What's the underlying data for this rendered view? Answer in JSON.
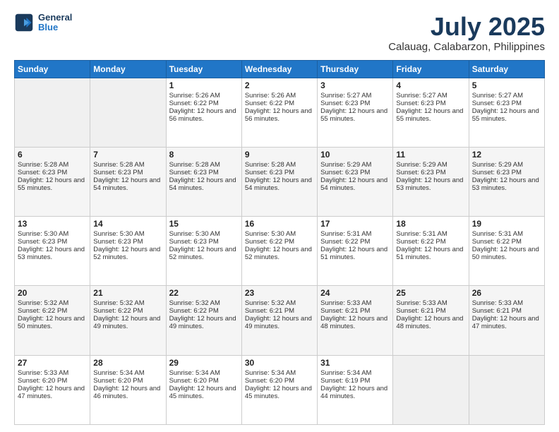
{
  "header": {
    "logo_line1": "General",
    "logo_line2": "Blue",
    "title": "July 2025",
    "subtitle": "Calauag, Calabarzon, Philippines"
  },
  "weekdays": [
    "Sunday",
    "Monday",
    "Tuesday",
    "Wednesday",
    "Thursday",
    "Friday",
    "Saturday"
  ],
  "weeks": [
    [
      {
        "day": "",
        "content": ""
      },
      {
        "day": "",
        "content": ""
      },
      {
        "day": "1",
        "content": "Sunrise: 5:26 AM\nSunset: 6:22 PM\nDaylight: 12 hours and 56 minutes."
      },
      {
        "day": "2",
        "content": "Sunrise: 5:26 AM\nSunset: 6:22 PM\nDaylight: 12 hours and 56 minutes."
      },
      {
        "day": "3",
        "content": "Sunrise: 5:27 AM\nSunset: 6:23 PM\nDaylight: 12 hours and 55 minutes."
      },
      {
        "day": "4",
        "content": "Sunrise: 5:27 AM\nSunset: 6:23 PM\nDaylight: 12 hours and 55 minutes."
      },
      {
        "day": "5",
        "content": "Sunrise: 5:27 AM\nSunset: 6:23 PM\nDaylight: 12 hours and 55 minutes."
      }
    ],
    [
      {
        "day": "6",
        "content": "Sunrise: 5:28 AM\nSunset: 6:23 PM\nDaylight: 12 hours and 55 minutes."
      },
      {
        "day": "7",
        "content": "Sunrise: 5:28 AM\nSunset: 6:23 PM\nDaylight: 12 hours and 54 minutes."
      },
      {
        "day": "8",
        "content": "Sunrise: 5:28 AM\nSunset: 6:23 PM\nDaylight: 12 hours and 54 minutes."
      },
      {
        "day": "9",
        "content": "Sunrise: 5:28 AM\nSunset: 6:23 PM\nDaylight: 12 hours and 54 minutes."
      },
      {
        "day": "10",
        "content": "Sunrise: 5:29 AM\nSunset: 6:23 PM\nDaylight: 12 hours and 54 minutes."
      },
      {
        "day": "11",
        "content": "Sunrise: 5:29 AM\nSunset: 6:23 PM\nDaylight: 12 hours and 53 minutes."
      },
      {
        "day": "12",
        "content": "Sunrise: 5:29 AM\nSunset: 6:23 PM\nDaylight: 12 hours and 53 minutes."
      }
    ],
    [
      {
        "day": "13",
        "content": "Sunrise: 5:30 AM\nSunset: 6:23 PM\nDaylight: 12 hours and 53 minutes."
      },
      {
        "day": "14",
        "content": "Sunrise: 5:30 AM\nSunset: 6:23 PM\nDaylight: 12 hours and 52 minutes."
      },
      {
        "day": "15",
        "content": "Sunrise: 5:30 AM\nSunset: 6:23 PM\nDaylight: 12 hours and 52 minutes."
      },
      {
        "day": "16",
        "content": "Sunrise: 5:30 AM\nSunset: 6:22 PM\nDaylight: 12 hours and 52 minutes."
      },
      {
        "day": "17",
        "content": "Sunrise: 5:31 AM\nSunset: 6:22 PM\nDaylight: 12 hours and 51 minutes."
      },
      {
        "day": "18",
        "content": "Sunrise: 5:31 AM\nSunset: 6:22 PM\nDaylight: 12 hours and 51 minutes."
      },
      {
        "day": "19",
        "content": "Sunrise: 5:31 AM\nSunset: 6:22 PM\nDaylight: 12 hours and 50 minutes."
      }
    ],
    [
      {
        "day": "20",
        "content": "Sunrise: 5:32 AM\nSunset: 6:22 PM\nDaylight: 12 hours and 50 minutes."
      },
      {
        "day": "21",
        "content": "Sunrise: 5:32 AM\nSunset: 6:22 PM\nDaylight: 12 hours and 49 minutes."
      },
      {
        "day": "22",
        "content": "Sunrise: 5:32 AM\nSunset: 6:22 PM\nDaylight: 12 hours and 49 minutes."
      },
      {
        "day": "23",
        "content": "Sunrise: 5:32 AM\nSunset: 6:21 PM\nDaylight: 12 hours and 49 minutes."
      },
      {
        "day": "24",
        "content": "Sunrise: 5:33 AM\nSunset: 6:21 PM\nDaylight: 12 hours and 48 minutes."
      },
      {
        "day": "25",
        "content": "Sunrise: 5:33 AM\nSunset: 6:21 PM\nDaylight: 12 hours and 48 minutes."
      },
      {
        "day": "26",
        "content": "Sunrise: 5:33 AM\nSunset: 6:21 PM\nDaylight: 12 hours and 47 minutes."
      }
    ],
    [
      {
        "day": "27",
        "content": "Sunrise: 5:33 AM\nSunset: 6:20 PM\nDaylight: 12 hours and 47 minutes."
      },
      {
        "day": "28",
        "content": "Sunrise: 5:34 AM\nSunset: 6:20 PM\nDaylight: 12 hours and 46 minutes."
      },
      {
        "day": "29",
        "content": "Sunrise: 5:34 AM\nSunset: 6:20 PM\nDaylight: 12 hours and 45 minutes."
      },
      {
        "day": "30",
        "content": "Sunrise: 5:34 AM\nSunset: 6:20 PM\nDaylight: 12 hours and 45 minutes."
      },
      {
        "day": "31",
        "content": "Sunrise: 5:34 AM\nSunset: 6:19 PM\nDaylight: 12 hours and 44 minutes."
      },
      {
        "day": "",
        "content": ""
      },
      {
        "day": "",
        "content": ""
      }
    ]
  ]
}
